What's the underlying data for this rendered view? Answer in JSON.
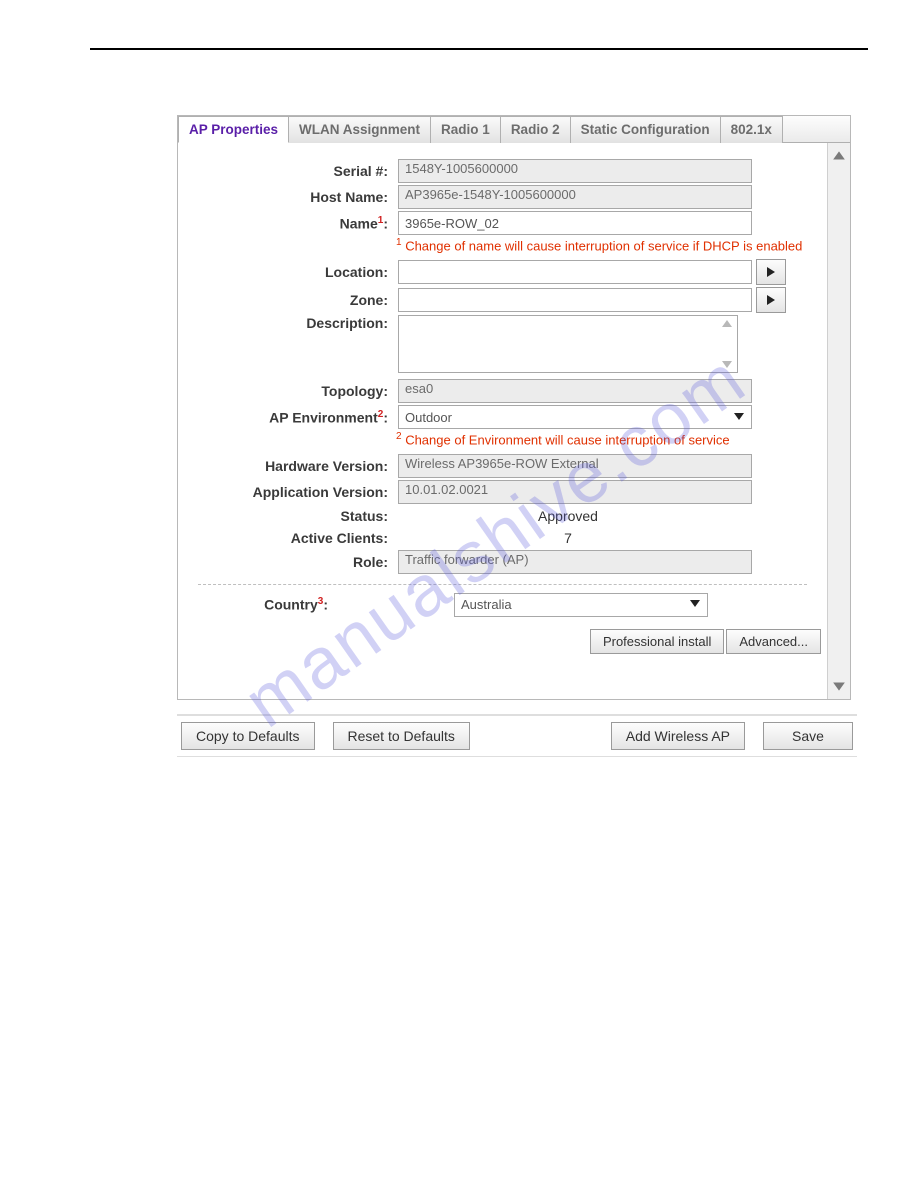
{
  "tabs": {
    "ap_properties": "AP Properties",
    "wlan_assignment": "WLAN Assignment",
    "radio1": "Radio 1",
    "radio2": "Radio 2",
    "static_config": "Static Configuration",
    "eight021x": "802.1x"
  },
  "labels": {
    "serial": "Serial #:",
    "host_name": "Host Name:",
    "name": "Name",
    "name_colon": ":",
    "location": "Location:",
    "zone": "Zone:",
    "description": "Description:",
    "topology": "Topology:",
    "ap_env": "AP Environment",
    "ap_env_colon": ":",
    "hw_version": "Hardware Version:",
    "app_version": "Application Version:",
    "status": "Status:",
    "active_clients": "Active Clients:",
    "role": "Role:",
    "country": "Country",
    "country_colon": ":"
  },
  "values": {
    "serial": "1548Y-1005600000",
    "host_name": "AP3965e-1548Y-1005600000",
    "name": "3965e-ROW_02",
    "location": "",
    "zone": "",
    "description": "",
    "topology": "esa0",
    "ap_env": "Outdoor",
    "hw_version": "Wireless AP3965e-ROW External",
    "app_version": "10.01.02.0021",
    "status": "Approved",
    "active_clients": "7",
    "role": "Traffic forwarder (AP)",
    "country": "Australia"
  },
  "footnotes": {
    "name": "Change of name will cause interruption of service if DHCP is enabled",
    "env": "Change of Environment will cause interruption of service"
  },
  "superscripts": {
    "one": "1",
    "two": "2",
    "three": "3"
  },
  "buttons": {
    "pro_install": "Professional install",
    "advanced": "Advanced...",
    "copy_defaults": "Copy to Defaults",
    "reset_defaults": "Reset to Defaults",
    "add_ap": "Add Wireless AP",
    "save": "Save"
  },
  "watermark": "manualshive.com"
}
